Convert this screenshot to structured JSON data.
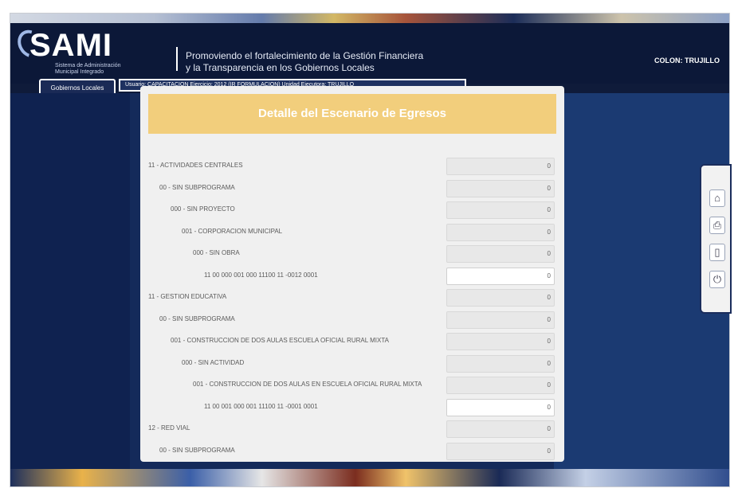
{
  "header": {
    "logo": "SAMI",
    "logo_sub": "Sistema de Administración Municipal Integrado",
    "slogan_line1": "Promoviendo el fortalecimiento de la Gestión Financiera",
    "slogan_line2": "y la Transparencia en los Gobiernos Locales",
    "location": "COLON: TRUJILLO"
  },
  "tabs": {
    "active": "Gobiernos Locales",
    "info": "Usuario: CAPACITACION    Ejercicio: 2012 (IR FORMULACION)    Unidad Ejecutora: TRUJILLO"
  },
  "panel": {
    "title": "Detalle del Escenario de Egresos",
    "rows": [
      {
        "label": "11 - ACTIVIDADES CENTRALES",
        "indent": 0,
        "value": "0",
        "white": false
      },
      {
        "label": "00 - SIN SUBPROGRAMA",
        "indent": 1,
        "value": "0",
        "white": false
      },
      {
        "label": "000 - SIN PROYECTO",
        "indent": 2,
        "value": "0",
        "white": false
      },
      {
        "label": "001 - CORPORACION MUNICIPAL",
        "indent": 3,
        "value": "0",
        "white": false
      },
      {
        "label": "000 - SIN OBRA",
        "indent": 4,
        "value": "0",
        "white": false
      },
      {
        "label": "11 00 000 001 000 11100 11 -0012 0001",
        "indent": 5,
        "value": "0",
        "white": true
      },
      {
        "label": "11 - GESTION EDUCATIVA",
        "indent": 0,
        "value": "0",
        "white": false
      },
      {
        "label": "00 - SIN SUBPROGRAMA",
        "indent": 1,
        "value": "0",
        "white": false
      },
      {
        "label": "001 - CONSTRUCCION DE DOS AULAS ESCUELA OFICIAL RURAL MIXTA",
        "indent": 2,
        "value": "0",
        "white": false
      },
      {
        "label": "000 - SIN ACTIVIDAD",
        "indent": 3,
        "value": "0",
        "white": false
      },
      {
        "label": "001 - CONSTRUCCION DE DOS AULAS EN ESCUELA OFICIAL RURAL MIXTA",
        "indent": 4,
        "value": "0",
        "white": false
      },
      {
        "label": "11 00 001 000 001 11100 11 -0001 0001",
        "indent": 5,
        "value": "0",
        "white": true
      },
      {
        "label": "12 - RED VIAL",
        "indent": 0,
        "value": "0",
        "white": false
      },
      {
        "label": "00 - SIN SUBPROGRAMA",
        "indent": 1,
        "value": "0",
        "white": false
      }
    ]
  },
  "toolbar": {
    "icons": [
      "home-icon",
      "print-icon",
      "document-icon",
      "power-icon"
    ],
    "glyphs": [
      "⌂",
      "⎙",
      "▯",
      "⏻"
    ]
  }
}
